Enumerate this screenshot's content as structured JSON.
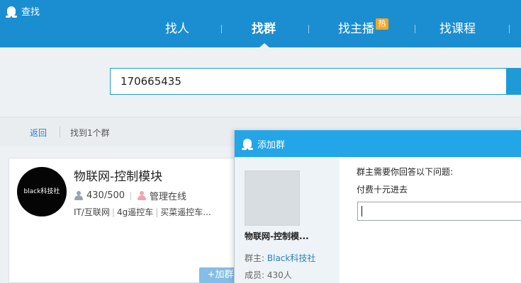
{
  "window": {
    "title": "查找"
  },
  "nav": {
    "items": [
      {
        "label": "找人"
      },
      {
        "label": "找群"
      },
      {
        "label": "找主播",
        "badge": "热"
      },
      {
        "label": "找课程"
      }
    ]
  },
  "search": {
    "value": "170665435"
  },
  "results": {
    "back_label": "返回",
    "found_text": "找到1个群"
  },
  "card": {
    "avatar_text": "black科技社",
    "name": "物联网-控制模块",
    "members": "430/500",
    "admin_status": "管理在线",
    "tags": [
      "IT/互联网",
      "4g遥控车",
      "买菜遥控车..."
    ],
    "add_label": "+加群"
  },
  "dialog": {
    "title": "添加群",
    "group_name": "物联网-控制模...",
    "owner_label": "群主:",
    "owner_name": "Black科技社",
    "members_label": "成员:",
    "members_value": "430人",
    "question_label": "群主需要你回答以下问题:",
    "question_text": "付费十元进去",
    "answer_value": ""
  },
  "colors": {
    "header": "#1b8ed1",
    "dialog_title": "#22a6e8",
    "link": "#2a7fc4",
    "hot_badge": "#f5a623"
  }
}
